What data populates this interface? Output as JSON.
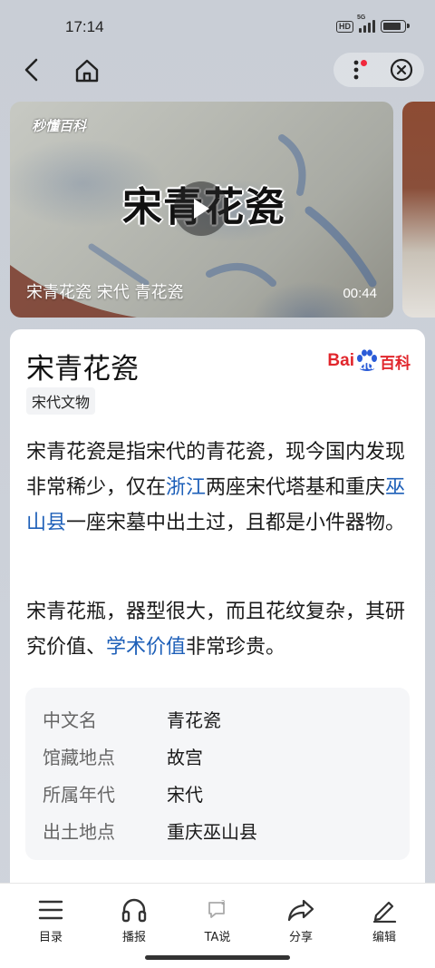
{
  "status_bar": {
    "time": "17:14",
    "hd": "HD",
    "signal_label": "5G",
    "battery_level": 0.85
  },
  "nav": {
    "back_icon": "chevron-left-icon",
    "home_icon": "home-icon",
    "more_icon": "more-vertical-icon",
    "close_icon": "close-circle-icon",
    "notification_dot_color": "#f0283c"
  },
  "video": {
    "logo_text": "秒懂百科",
    "title_overlay": "宋青花瓷",
    "caption": "宋青花瓷 宋代 青花瓷",
    "duration": "00:44"
  },
  "article": {
    "title": "宋青花瓷",
    "source_logo": {
      "bai": "Bai",
      "du": "du",
      "ke": "百科"
    },
    "tag": "宋代文物",
    "para1": [
      {
        "text": "宋青花瓷是指宋代的青花瓷，现今国内发现非常稀少，仅在",
        "link": false
      },
      {
        "text": "浙江",
        "link": true
      },
      {
        "text": "两座宋代塔基和重庆",
        "link": false
      },
      {
        "text": "巫山县",
        "link": true
      },
      {
        "text": "一座宋墓中出土过，且都是小件器物。",
        "link": false
      }
    ],
    "para2": [
      {
        "text": "宋青花瓶，器型很大，而且花纹复杂，其研究价值、",
        "link": false
      },
      {
        "text": "学术价值",
        "link": true
      },
      {
        "text": "非常珍贵。",
        "link": false
      }
    ],
    "info": [
      {
        "key": "中文名",
        "value": "青花瓷"
      },
      {
        "key": "馆藏地点",
        "value": "故宫"
      },
      {
        "key": "所属年代",
        "value": "宋代"
      },
      {
        "key": "出土地点",
        "value": "重庆巫山县"
      }
    ],
    "link_color": "#1d5fb8"
  },
  "toolbar": {
    "items": [
      {
        "label": "目录",
        "icon": "list-icon"
      },
      {
        "label": "播报",
        "icon": "headphones-icon"
      },
      {
        "label": "TA说",
        "icon": "comment-icon"
      },
      {
        "label": "分享",
        "icon": "share-icon"
      },
      {
        "label": "编辑",
        "icon": "edit-icon"
      }
    ]
  }
}
